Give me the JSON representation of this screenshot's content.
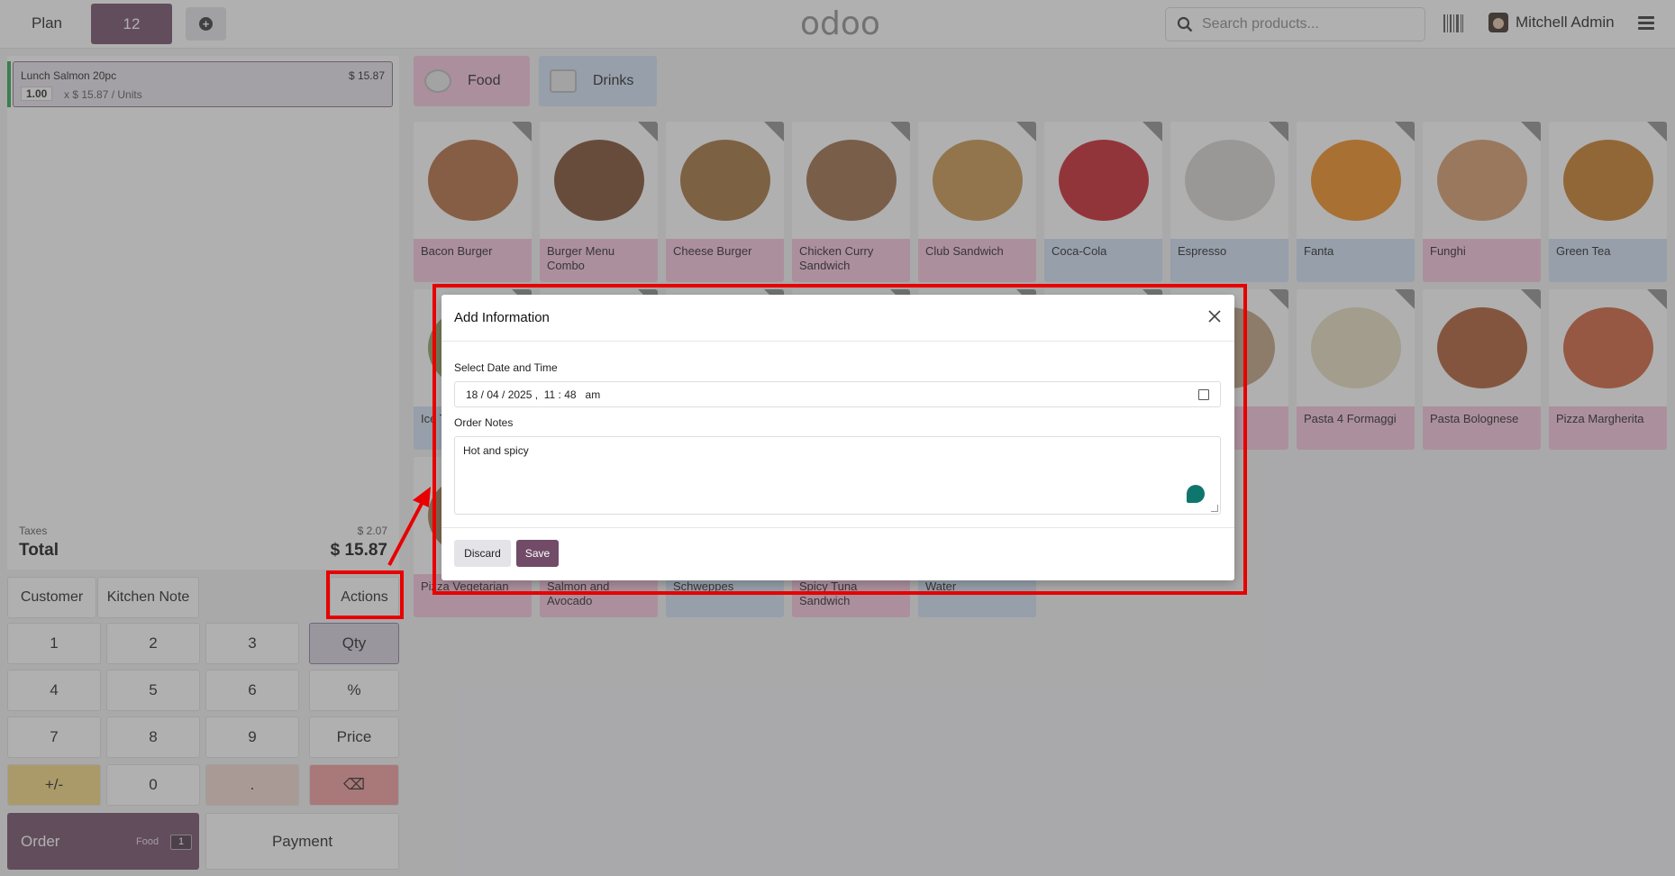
{
  "topbar": {
    "plan_label": "Plan",
    "table_tab": "12",
    "add_icon": "plus-circle-icon",
    "logo": "odoo",
    "search_placeholder": "Search products...",
    "barcode_icon": "barcode-icon",
    "user_name": "Mitchell Admin",
    "menu_icon": "hamburger-menu-icon"
  },
  "order": {
    "line": {
      "name": "Lunch Salmon 20pc",
      "price": "$ 15.87",
      "qty": "1.00",
      "unit": "x $ 15.87 / Units"
    },
    "taxes_label": "Taxes",
    "taxes_value": "$ 2.07",
    "total_label": "Total",
    "total_value": "$ 15.87"
  },
  "controls": {
    "customer": "Customer",
    "kitchen_note": "Kitchen Note",
    "actions": "Actions"
  },
  "numpad": {
    "k1": "1",
    "k2": "2",
    "k3": "3",
    "qty": "Qty",
    "k4": "4",
    "k5": "5",
    "k6": "6",
    "pct": "%",
    "k7": "7",
    "k8": "8",
    "k9": "9",
    "price": "Price",
    "pm": "+/-",
    "k0": "0",
    "dot": ".",
    "bs": "⌫"
  },
  "order_button": {
    "label": "Order",
    "category": "Food",
    "count": "1"
  },
  "payment_button": "Payment",
  "categories": [
    {
      "label": "Food",
      "color": "#f7c4dc"
    },
    {
      "label": "Drinks",
      "color": "#cfe0f5"
    }
  ],
  "products_row1": [
    {
      "name": "Bacon Burger",
      "type": "pink"
    },
    {
      "name": "Burger Menu Combo",
      "type": "pink"
    },
    {
      "name": "Cheese Burger",
      "type": "pink"
    },
    {
      "name": "Chicken Curry Sandwich",
      "type": "pink"
    },
    {
      "name": "Club Sandwich",
      "type": "pink"
    },
    {
      "name": "Coca-Cola",
      "type": "blue"
    },
    {
      "name": "Espresso",
      "type": "blue"
    },
    {
      "name": "Fanta",
      "type": "blue"
    },
    {
      "name": "Funghi",
      "type": "pink"
    },
    {
      "name": "Green Tea",
      "type": "blue"
    }
  ],
  "products_row2": [
    {
      "name": "Ice Tea",
      "type": "blue"
    },
    {
      "name": "",
      "type": "pink"
    },
    {
      "name": "",
      "type": "blue"
    },
    {
      "name": "",
      "type": "pink"
    },
    {
      "name": "",
      "type": "pink"
    },
    {
      "name": "",
      "type": "blue"
    },
    {
      "name": "",
      "type": "pink"
    },
    {
      "name": "Pasta 4 Formaggi",
      "type": "pink"
    },
    {
      "name": "Pasta Bolognese",
      "type": "pink"
    },
    {
      "name": "Pizza Margherita",
      "type": "pink"
    }
  ],
  "products_row3": [
    {
      "name": "Pizza Vegetarian",
      "type": "pink"
    },
    {
      "name": "Salmon and Avocado",
      "type": "pink"
    },
    {
      "name": "Schweppes",
      "type": "blue"
    },
    {
      "name": "Spicy Tuna Sandwich",
      "type": "pink"
    },
    {
      "name": "Water",
      "type": "blue"
    }
  ],
  "modal": {
    "title": "Add Information",
    "date_label": "Select Date and Time",
    "date_value": "18 / 04 / 2025 ,  11 : 48   am",
    "notes_label": "Order Notes",
    "notes_value": "Hot and spicy",
    "discard": "Discard",
    "save": "Save"
  },
  "colors": {
    "brand": "#714b67",
    "annotation": "#e80000"
  }
}
